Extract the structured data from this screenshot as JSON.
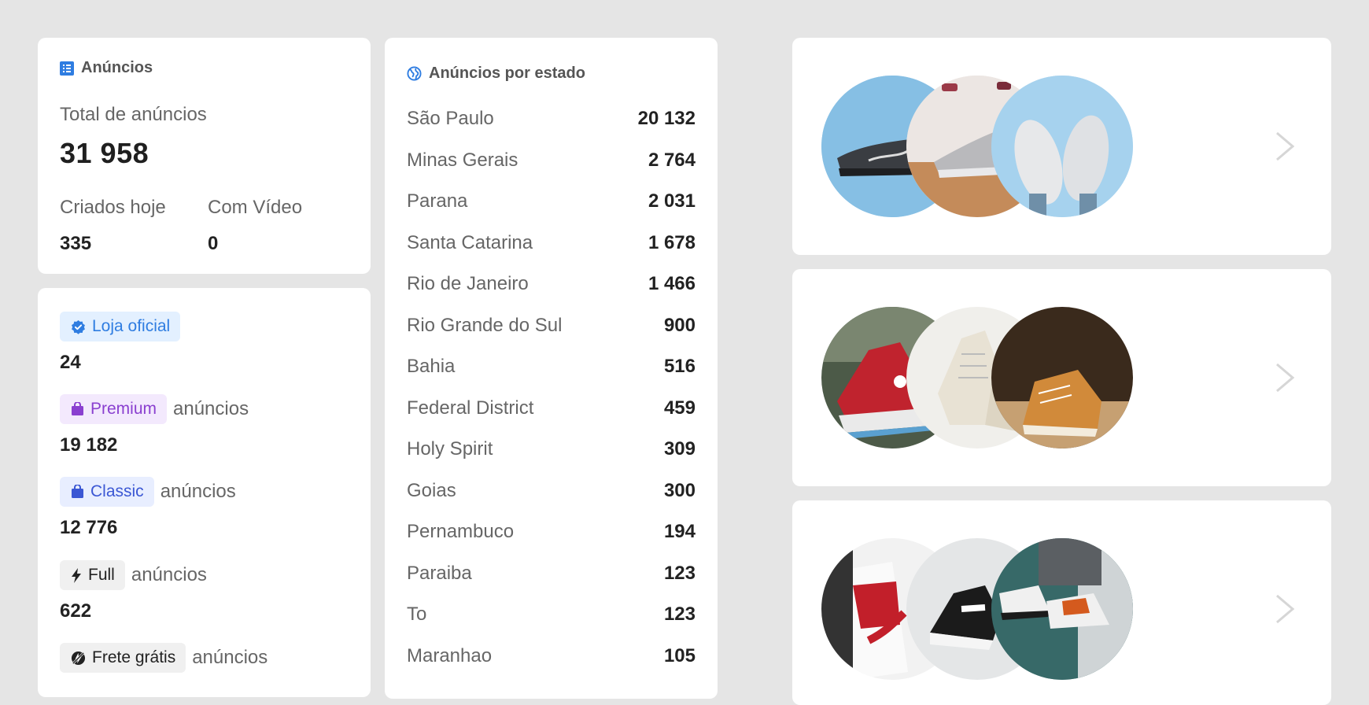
{
  "summary": {
    "title": "Anúncios",
    "total_label": "Total de anúncios",
    "total_value": "31 958",
    "today_label": "Criados hoje",
    "today_value": "335",
    "video_label": "Com Vídeo",
    "video_value": "0"
  },
  "badges": [
    {
      "label": "Loja oficial",
      "suffix": "",
      "count": "24"
    },
    {
      "label": "Premium",
      "suffix": "anúncios",
      "count": "19 182"
    },
    {
      "label": "Classic",
      "suffix": "anúncios",
      "count": "12 776"
    },
    {
      "label": "Full",
      "suffix": "anúncios",
      "count": "622"
    },
    {
      "label": "Frete grátis",
      "suffix": "anúncios",
      "count": ""
    }
  ],
  "states": {
    "title": "Anúncios por estado",
    "rows": [
      {
        "name": "São Paulo",
        "count": "20 132"
      },
      {
        "name": "Minas Gerais",
        "count": "2 764"
      },
      {
        "name": "Parana",
        "count": "2 031"
      },
      {
        "name": "Santa Catarina",
        "count": "1 678"
      },
      {
        "name": "Rio de Janeiro",
        "count": "1 466"
      },
      {
        "name": "Rio Grande do Sul",
        "count": "900"
      },
      {
        "name": "Bahia",
        "count": "516"
      },
      {
        "name": "Federal District",
        "count": "459"
      },
      {
        "name": "Holy Spirit",
        "count": "309"
      },
      {
        "name": "Goias",
        "count": "300"
      },
      {
        "name": "Pernambuco",
        "count": "194"
      },
      {
        "name": "Paraiba",
        "count": "123"
      },
      {
        "name": "To",
        "count": "123"
      },
      {
        "name": "Maranhao",
        "count": "105"
      }
    ]
  },
  "colors": {
    "background": "#e5e5e5",
    "card": "#ffffff",
    "accent_blue": "#2f7de1",
    "premium_purple": "#8a3fd0",
    "classic_blue": "#3b57d4"
  },
  "icons": {
    "summary": "list-icon",
    "states": "globe-icon",
    "official": "verified-check-icon",
    "premium": "bag-icon",
    "classic": "bag-icon",
    "full": "lightning-icon",
    "frete": "no-shipping-icon",
    "nav": "chevron-right-icon"
  }
}
